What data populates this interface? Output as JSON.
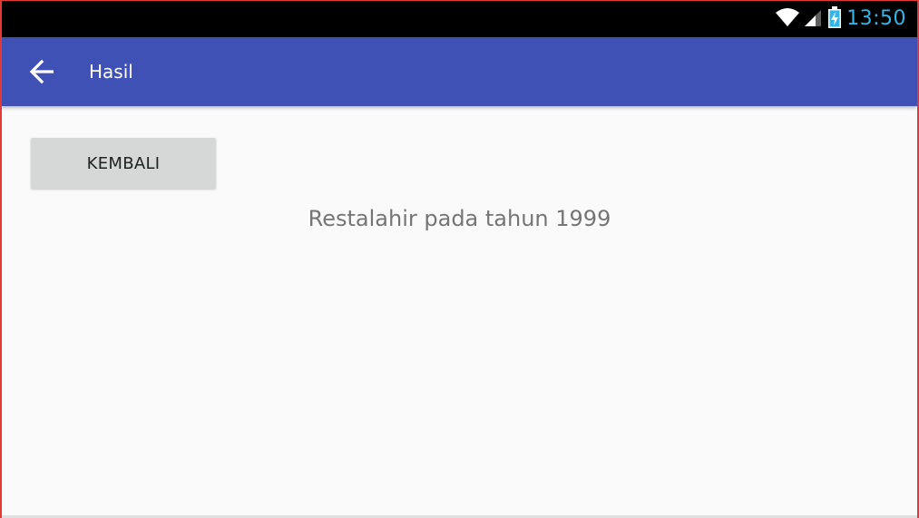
{
  "status_bar": {
    "time": "13:50",
    "icons": [
      "wifi-icon",
      "cell-signal-icon",
      "battery-charging-icon"
    ],
    "time_color": "#33b5e5"
  },
  "app_bar": {
    "title": "Hasil",
    "back_icon": "arrow-left-icon",
    "color": "#3f51b5"
  },
  "main": {
    "back_button_label": "KEMBALI",
    "result_text": "Restalahir pada tahun 1999"
  }
}
